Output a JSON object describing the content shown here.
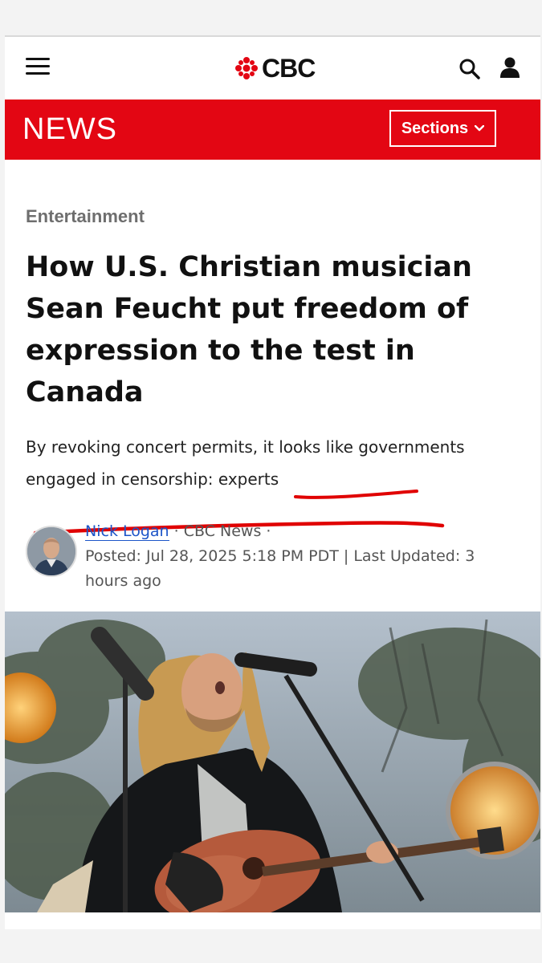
{
  "header": {
    "menu_icon": "hamburger-menu-icon",
    "logo_text": "CBC",
    "logo_icon": "cbc-gem-icon",
    "search_icon": "search-icon",
    "user_icon": "user-icon"
  },
  "newsbar": {
    "title": "NEWS",
    "sections_label": "Sections",
    "chevron_icon": "chevron-down-icon",
    "color": "#e30613"
  },
  "article": {
    "category": "Entertainment",
    "headline": "How U.S. Christian musician Sean Feucht put freedom of expression to the test in Canada",
    "dek_part1": "By revoking concert permits, ",
    "dek_part2": "it looks like governments engaged in censorship: experts",
    "author": "Nick Logan",
    "separator": " · ",
    "source": "CBC News",
    "trailing_sep": " ·",
    "posted": "Posted: Jul 28, 2025 5:18 PM PDT | Last Updated: 3 hours ago"
  },
  "annotation": {
    "underline_color": "#e00000"
  }
}
